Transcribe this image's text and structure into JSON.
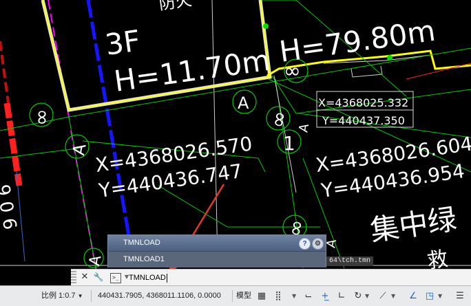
{
  "drawing": {
    "building_left": {
      "floors": "3F",
      "height": "H=11.70m"
    },
    "building_right": {
      "height": "H=79.80m"
    },
    "partial_label_top": "防火",
    "coord_box": {
      "x": "X=4368025.332",
      "y": "Y=440437.350"
    },
    "coord_left": {
      "x": "X=4368026.570",
      "y": "Y=440436.747"
    },
    "coord_right": {
      "x": "X=4368026.604",
      "y": "Y=440436.954"
    },
    "area_label": "集中绿",
    "area_label_2": "救",
    "circle_labels": [
      "A",
      "∞",
      "∞",
      "1",
      "∞",
      "∞",
      "∞"
    ],
    "triangle_labels": [
      "A",
      "A",
      "A",
      "A"
    ],
    "left_edge_text": "9 0 6"
  },
  "autocomplete": {
    "items": [
      "TMNLOAD",
      "TMNLOAD1"
    ],
    "help_icon": "?"
  },
  "path_tooltip": "64\\tch.tmn",
  "command_line": {
    "input": "TMNLOAD",
    "prompt_icon": ">_"
  },
  "status_bar": {
    "scale": "比例 1:0.7",
    "coordinates": "440431.7905, 4368011.1106, 0.0000",
    "model": "模型"
  },
  "colors": {
    "background": "#000000",
    "building_outline": "#ffff00",
    "property_line": "#00ff00",
    "axis_line": "#0000ff",
    "fire_lane": "#ff00ff",
    "boundary": "#ff0000",
    "annotation_arrow": "#e53828"
  }
}
